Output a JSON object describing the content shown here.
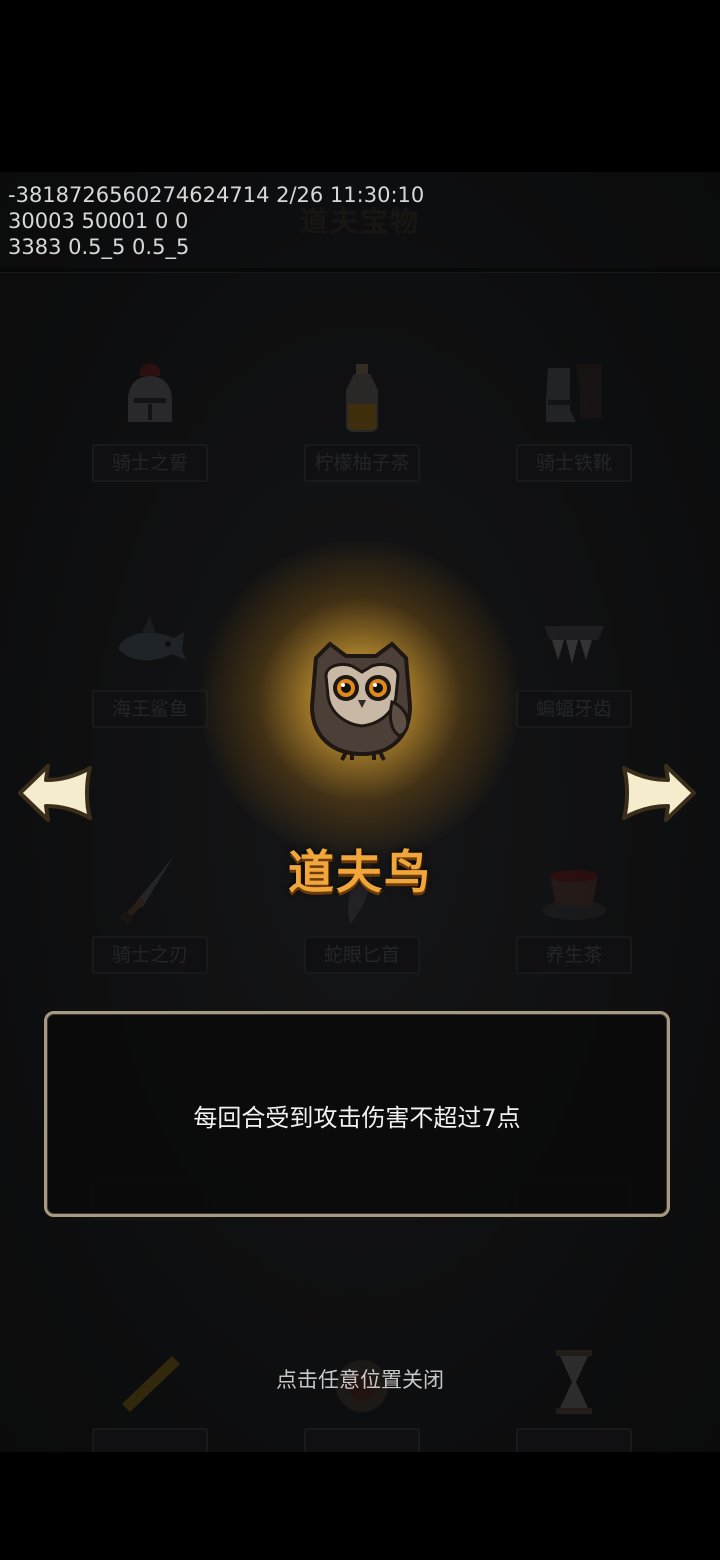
{
  "debug": {
    "line1": "-3818726560274624714 2/26 11:30:10",
    "line2": "30003 50001 0 0",
    "line3": "3383 0.5_5 0.5_5"
  },
  "page": {
    "title": "道夫宝物"
  },
  "treasures": [
    {
      "name": "骑士之誓",
      "icon": "knight-helmet-icon"
    },
    {
      "name": "柠檬柚子茶",
      "icon": "tea-bottle-icon"
    },
    {
      "name": "骑士铁靴",
      "icon": "iron-boots-icon"
    },
    {
      "name": "海王鲨鱼",
      "icon": "shark-icon"
    },
    {
      "name": "道夫鸟",
      "icon": "owl-icon"
    },
    {
      "name": "蝙蝠牙齿",
      "icon": "bat-teeth-icon"
    },
    {
      "name": "骑士之刃",
      "icon": "sword-icon"
    },
    {
      "name": "蛇眼匕首",
      "icon": "dagger-icon"
    },
    {
      "name": "养生茶",
      "icon": "tea-cup-icon"
    }
  ],
  "popup": {
    "item_name": "道夫鸟",
    "item_icon": "owl-icon",
    "description": "每回合受到攻击伤害不超过7点",
    "close_hint": "点击任意位置关闭",
    "prev_icon": "arrow-left-icon",
    "next_icon": "arrow-right-icon"
  },
  "colors": {
    "item_name": "#f0a63a",
    "panel_border": "#a89a82",
    "glow": "#ffde78"
  }
}
